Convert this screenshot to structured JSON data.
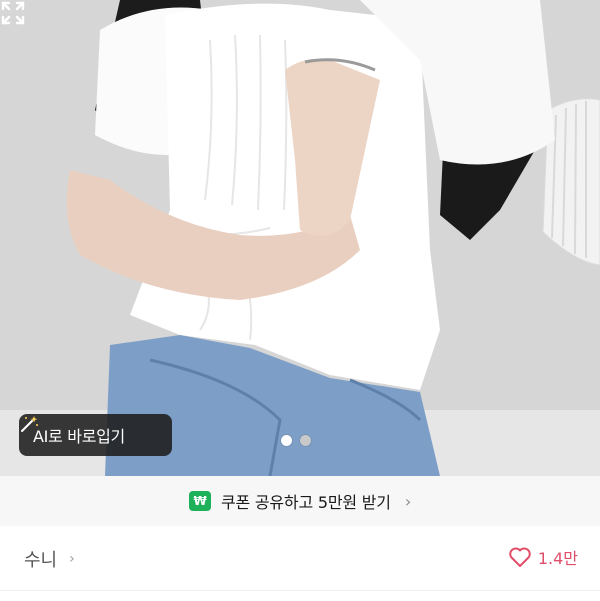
{
  "photo": {
    "ai_button_label": "AI로 바로입기",
    "ai_button_icon": "magic-wand-icon",
    "pagination": {
      "total": 2,
      "current": 1
    },
    "expand_icon": "expand-icon"
  },
  "coupon": {
    "badge": "₩",
    "text": "쿠폰 공유하고 5만원 받기",
    "chevron": "›"
  },
  "seller": {
    "name": "수니",
    "chevron": "›"
  },
  "likes": {
    "icon": "heart-icon",
    "count": "1.4만",
    "color": "#e04e6a"
  },
  "colors": {
    "accent_green": "#1fb05a",
    "heart_pink": "#e04e6a"
  }
}
